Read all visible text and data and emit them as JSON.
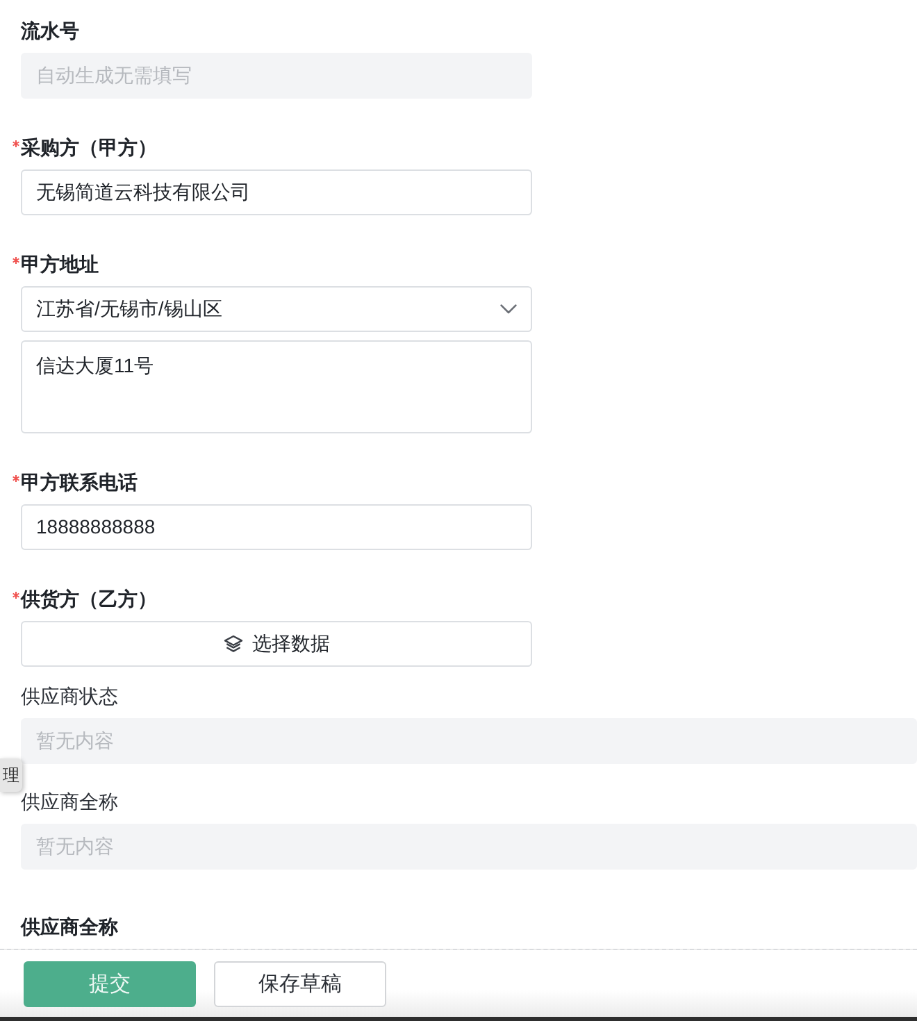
{
  "fields": [
    {
      "kind": "readonly",
      "label": "流水号",
      "required": false,
      "placeholder": "自动生成无需填写"
    },
    {
      "kind": "input",
      "label": "采购方（甲方）",
      "required": true,
      "value": "无锡简道云科技有限公司"
    },
    {
      "kind": "address",
      "label": "甲方地址",
      "required": true,
      "region": "江苏省/无锡市/锡山区",
      "detail": "信达大厦11号"
    },
    {
      "kind": "input",
      "label": "甲方联系电话",
      "required": true,
      "value": "18888888888"
    },
    {
      "kind": "data_select",
      "label": "供货方（乙方）",
      "required": true,
      "button": "选择数据",
      "linked_fields": [
        {
          "label": "供应商状态",
          "placeholder": "暂无内容"
        },
        {
          "label": "供应商全称",
          "placeholder": "暂无内容"
        }
      ]
    },
    {
      "kind": "heading",
      "label": "供应商全称",
      "required": false
    }
  ],
  "side_tab": {
    "label": "理"
  },
  "actions": [
    {
      "kind": "primary",
      "label": "提交"
    },
    {
      "kind": "secondary",
      "label": "保存草稿"
    }
  ]
}
